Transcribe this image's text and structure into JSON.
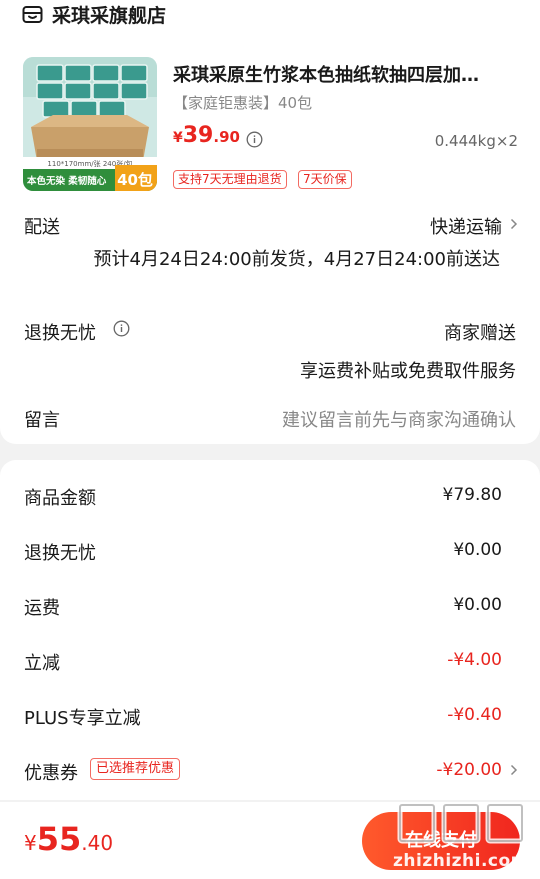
{
  "store": {
    "name": "采琪采旗舰店",
    "icon": "store-icon"
  },
  "product": {
    "title": "采琪采原生竹浆本色抽纸软抽四层加…",
    "spec": "【家庭钜惠装】40包",
    "price_currency": "¥",
    "price_int": "39",
    "price_dec": ".90",
    "weight": "0.444kg×2",
    "tags": [
      "支持7天无理由退货",
      "7天价保"
    ],
    "image": {
      "size_text": "110*170mm/张 240张/包",
      "banner_left": "本色无染 柔韧随心",
      "banner_count": "40包"
    }
  },
  "delivery": {
    "label": "配送",
    "method": "快递运输",
    "eta": "预计4月24日24:00前发货，4月27日24:00前送达"
  },
  "returns": {
    "label": "退换无忧",
    "value": "商家赠送",
    "desc": "享运费补贴或免费取件服务"
  },
  "message": {
    "label": "留言",
    "placeholder": "建议留言前先与商家沟通确认"
  },
  "summary": [
    {
      "label": "商品金额",
      "value": "¥79.80",
      "highlight": false
    },
    {
      "label": "退换无忧",
      "value": "¥0.00",
      "highlight": false
    },
    {
      "label": "运费",
      "value": "¥0.00",
      "highlight": false
    },
    {
      "label": "立减",
      "value": "-¥4.00",
      "highlight": true
    },
    {
      "label": "PLUS专享立减",
      "value": "-¥0.40",
      "highlight": true
    },
    {
      "label": "优惠券",
      "value": "-¥20.00",
      "highlight": true
    }
  ],
  "coupon_badge": "已选推荐优惠",
  "footer": {
    "total_currency": "¥",
    "total_int": "55",
    "total_dec": ".40",
    "pay_label": "在线支付",
    "watermark": "zhizhizhi.com"
  },
  "colors": {
    "accent": "#e8251f",
    "button": "#f0261e"
  }
}
